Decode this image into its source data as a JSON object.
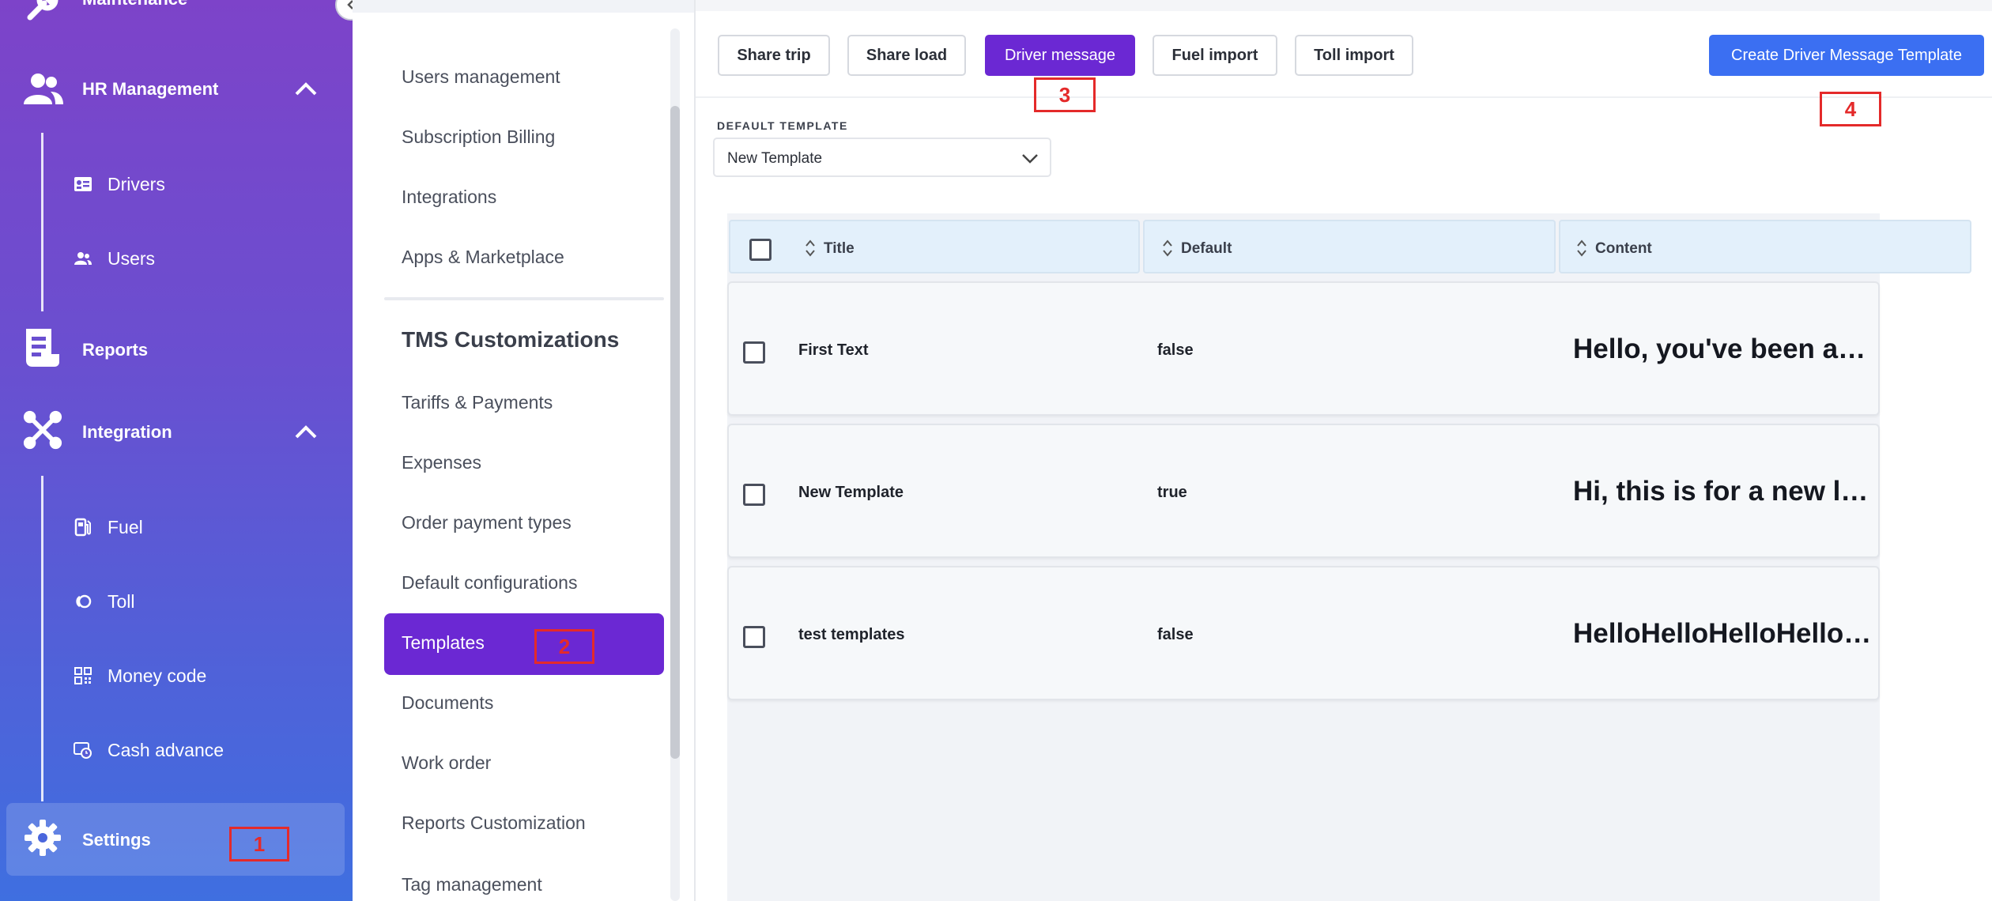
{
  "sidebar": {
    "items": [
      {
        "label": "Maintenance",
        "icon": "wrench-icon"
      },
      {
        "label": "HR Management",
        "icon": "users-group-icon"
      },
      {
        "label": "Reports",
        "icon": "report-icon"
      },
      {
        "label": "Integration",
        "icon": "integration-icon"
      },
      {
        "label": "Settings",
        "icon": "gear-icon"
      }
    ],
    "hr_sub": [
      {
        "label": "Drivers",
        "icon": "id-card-icon"
      },
      {
        "label": "Users",
        "icon": "users-icon"
      }
    ],
    "integration_sub": [
      {
        "label": "Fuel",
        "icon": "fuel-pump-icon"
      },
      {
        "label": "Toll",
        "icon": "toll-icon"
      },
      {
        "label": "Money code",
        "icon": "qr-code-icon"
      },
      {
        "label": "Cash advance",
        "icon": "cash-advance-icon"
      }
    ]
  },
  "settings_menu": {
    "items_top": [
      "Users management",
      "Subscription Billing",
      "Integrations",
      "Apps & Marketplace"
    ],
    "heading": "TMS Customizations",
    "items_bottom": [
      "Tariffs & Payments",
      "Expenses",
      "Order payment types",
      "Default configurations",
      "Templates",
      "Documents",
      "Work order",
      "Reports Customization",
      "Tag management"
    ],
    "active": "Templates"
  },
  "toolbar": {
    "tabs": [
      "Share trip",
      "Share load",
      "Driver message",
      "Fuel import",
      "Toll import"
    ],
    "active_tab": "Driver message",
    "create_label": "Create Driver Message Template"
  },
  "default_template": {
    "label": "DEFAULT TEMPLATE",
    "value": "New Template"
  },
  "table": {
    "columns": [
      "Title",
      "Default",
      "Content"
    ],
    "rows": [
      {
        "title": "First Text",
        "default": "false",
        "content": "Hello, you've been assigned a new load"
      },
      {
        "title": "New Template",
        "default": "true",
        "content": "Hi, this is for a new load, please confirm"
      },
      {
        "title": "test templates",
        "default": "false",
        "content": "HelloHelloHelloHelloHelloHello"
      }
    ]
  },
  "markers": [
    "1",
    "2",
    "3",
    "4"
  ],
  "colors": {
    "accent_purple": "#6b28d3",
    "primary_blue": "#3b6ff2",
    "marker_red": "#e42a2a"
  }
}
